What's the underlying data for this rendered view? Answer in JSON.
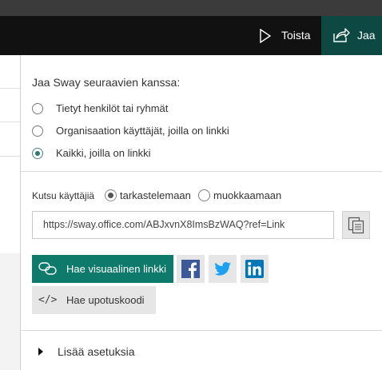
{
  "toolbar": {
    "play_label": "Toista",
    "share_label": "Jaa"
  },
  "share_panel": {
    "heading": "Jaa Sway seuraavien kanssa:",
    "audience_options": [
      {
        "label": "Tietyt henkilöt tai ryhmät",
        "selected": false
      },
      {
        "label": "Organisaation käyttäjät, joilla on linkki",
        "selected": false
      },
      {
        "label": "Kaikki, joilla on linkki",
        "selected": true
      }
    ],
    "invite_label": "Kutsu käyttäjiä",
    "permission_options": [
      {
        "label": "tarkastelemaan",
        "selected": true
      },
      {
        "label": "muokkaamaan",
        "selected": false
      }
    ],
    "link_value": "https://sway.office.com/ABJxvnX8ImsBzWAQ?ref=Link",
    "visual_link_label": "Hae visuaalinen linkki",
    "embed_label": "Hae upotuskoodi",
    "embed_icon_text": "</>",
    "more_settings_label": "Lisää asetuksia"
  },
  "colors": {
    "toolbar_bg": "#111111",
    "share_active_bg": "#0d4843",
    "accent": "#0d7a6c",
    "facebook": "#3b5998",
    "twitter": "#1da1f2",
    "linkedin": "#0077b5"
  },
  "icons": {
    "play": "play-triangle-icon",
    "share": "share-arrow-icon",
    "copy": "copy-clipboard-icon",
    "visual_link": "link-chain-icon",
    "facebook": "facebook-icon",
    "twitter": "twitter-icon",
    "linkedin": "linkedin-icon",
    "embed": "code-embed-icon",
    "expand": "caret-right-icon"
  }
}
